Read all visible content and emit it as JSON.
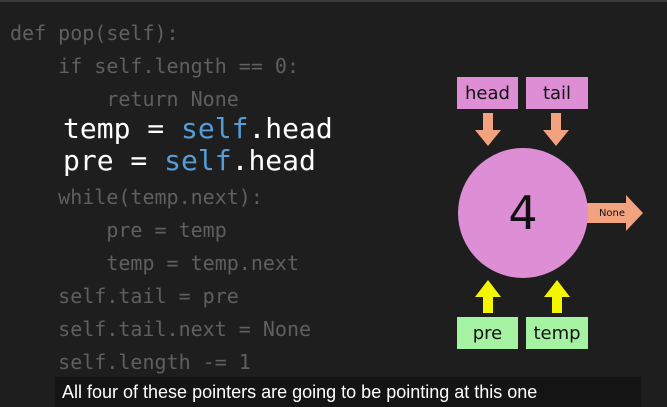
{
  "code": {
    "lines": [
      {
        "text": "def pop(self):",
        "emphasis": false
      },
      {
        "text": "    if self.length == 0:",
        "emphasis": false
      },
      {
        "text": "        return None",
        "emphasis": false
      },
      {
        "text": "temp = ",
        "self": "self",
        "rest": ".head",
        "emphasis": true
      },
      {
        "text": "pre = ",
        "self": "self",
        "rest": ".head",
        "emphasis": true
      },
      {
        "text": "    while(temp.next):",
        "emphasis": false
      },
      {
        "text": "        pre = temp",
        "emphasis": false
      },
      {
        "text": "        temp = temp.next",
        "emphasis": false
      },
      {
        "text": "    self.tail = pre",
        "emphasis": false
      },
      {
        "text": "    self.tail.next = None",
        "emphasis": false
      },
      {
        "text": "    self.length -= 1",
        "emphasis": false
      }
    ]
  },
  "diagram": {
    "head_label": "head",
    "tail_label": "tail",
    "node_value": "4",
    "next_label": "None",
    "pre_label": "pre",
    "temp_label": "temp",
    "colors": {
      "node": "#dd8ed5",
      "pink_label": "#dd8ed5",
      "green_label": "#a6f2a3",
      "down_arrow": "#f2a27f",
      "up_arrow": "#f5f500",
      "next_arrow": "#f2a27f"
    }
  },
  "caption": "All four of these pointers are going to be pointing at this one"
}
